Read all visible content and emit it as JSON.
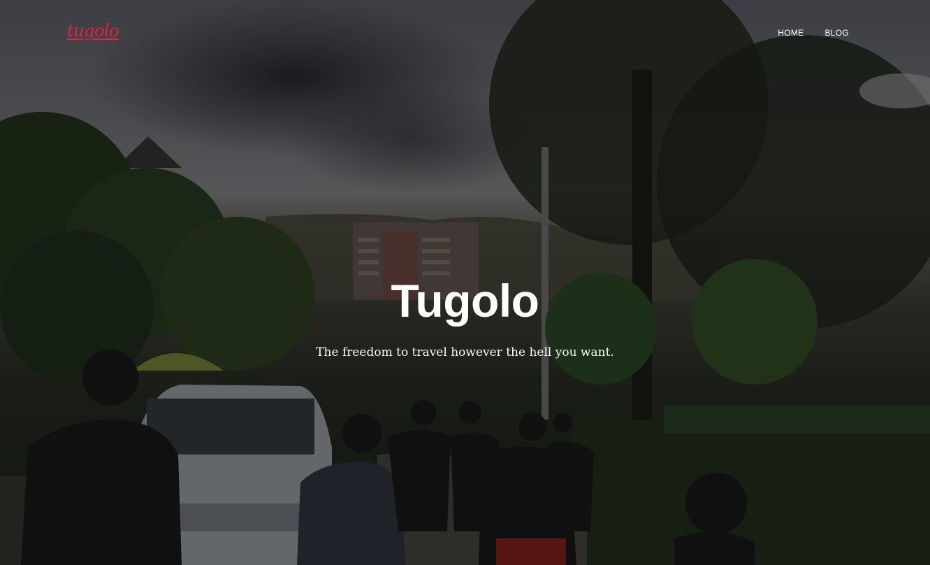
{
  "header": {
    "logo_text": "tugolo",
    "nav": [
      {
        "label": "HOME"
      },
      {
        "label": "BLOG"
      }
    ]
  },
  "hero": {
    "title": "Tugolo",
    "subtitle": "The freedom to travel however the hell you want."
  },
  "colors": {
    "brand": "#e0243c",
    "text": "#ffffff"
  }
}
